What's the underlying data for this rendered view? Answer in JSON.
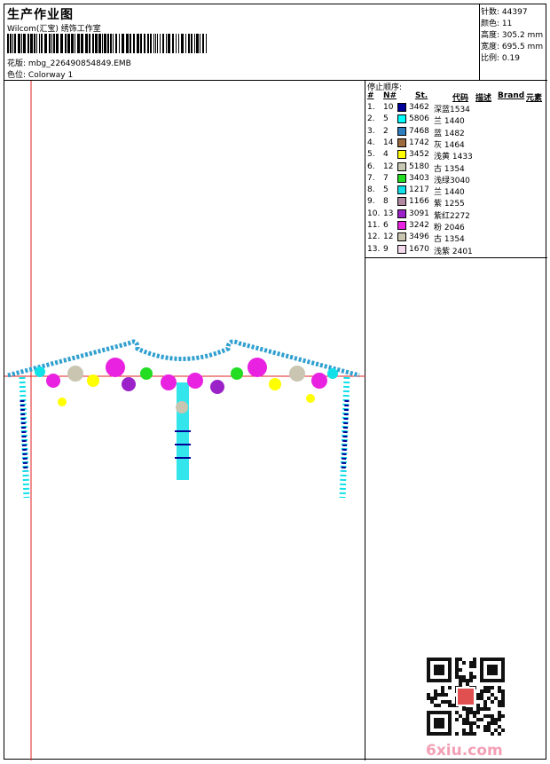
{
  "header": {
    "title": "生产作业图",
    "company": "Wilcom(汇宝) 绣饰工作室",
    "design_label": "花版:",
    "design_file": "mbg_226490854849.EMB",
    "colorway_label": "色位:",
    "colorway": "Colorway 1"
  },
  "stats": [
    {
      "label": "针数:",
      "value": "44397"
    },
    {
      "label": "颜色:",
      "value": "11"
    },
    {
      "label": "高度:",
      "value": "305.2 mm"
    },
    {
      "label": "宽度:",
      "value": "695.5 mm"
    },
    {
      "label": "比例:",
      "value": "0.19"
    }
  ],
  "panel": {
    "stop_sequence_label": "停止顺序:",
    "columns": [
      "#",
      "N#",
      "St.",
      "代码",
      "描述",
      "Brand",
      "元素"
    ],
    "rows": [
      {
        "idx": "1.",
        "n": "10",
        "color": "#000099",
        "st": "3462",
        "code": "深蓝1534"
      },
      {
        "idx": "2.",
        "n": "5",
        "color": "#00ffff",
        "st": "5806",
        "code": "兰 1440"
      },
      {
        "idx": "3.",
        "n": "2",
        "color": "#2f7fbf",
        "st": "7468",
        "code": "蓝 1482"
      },
      {
        "idx": "4.",
        "n": "14",
        "color": "#9c6b3f",
        "st": "1742",
        "code": "灰 1464"
      },
      {
        "idx": "5.",
        "n": "4",
        "color": "#ffff00",
        "st": "3452",
        "code": "浅黄 1433"
      },
      {
        "idx": "6.",
        "n": "12",
        "color": "#c8c8b4",
        "st": "5180",
        "code": "古 1354"
      },
      {
        "idx": "7.",
        "n": "7",
        "color": "#22dd22",
        "st": "3403",
        "code": "浅绿3040"
      },
      {
        "idx": "8.",
        "n": "5",
        "color": "#10e0e8",
        "st": "1217",
        "code": "兰 1440"
      },
      {
        "idx": "9.",
        "n": "8",
        "color": "#b08aa0",
        "st": "1166",
        "code": "紫 1255"
      },
      {
        "idx": "10.",
        "n": "13",
        "color": "#9a22c8",
        "st": "3091",
        "code": "紫红2272"
      },
      {
        "idx": "11.",
        "n": "6",
        "color": "#e822e0",
        "st": "3242",
        "code": "粉 2046"
      },
      {
        "idx": "12.",
        "n": "12",
        "color": "#c9c5b0",
        "st": "3496",
        "code": "古 1354"
      },
      {
        "idx": "13.",
        "n": "9",
        "color": "#f2d9ec",
        "st": "1670",
        "code": "浅紫 2401"
      }
    ]
  },
  "watermark": {
    "site": "6xiu.com"
  }
}
